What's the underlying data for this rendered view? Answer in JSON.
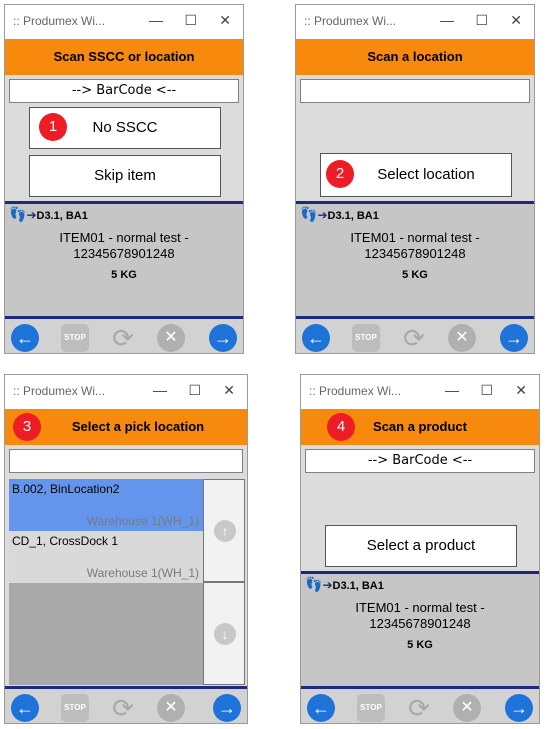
{
  "window_title": ":: Produmex Wi...",
  "controls": {
    "minimize": "—",
    "maximize": "☐",
    "close": "✕"
  },
  "item": {
    "location": "D3.1, BA1",
    "name": "ITEM01 - normal test -",
    "code": "12345678901248",
    "qty": "5 KG"
  },
  "panel1": {
    "badge": "1",
    "header": "Scan SSCC or location",
    "barcode": "--> BarCode <--",
    "no_sscc": "No SSCC",
    "skip": "Skip item"
  },
  "panel2": {
    "badge": "2",
    "header": "Scan a location",
    "barcode": "",
    "select_location": "Select location"
  },
  "panel3": {
    "badge": "3",
    "header": "Select a pick location",
    "search": "",
    "rows": [
      {
        "name": "B.002, BinLocation2",
        "warehouse": "Warehouse 1(WH_1)"
      },
      {
        "name": "CD_1, CrossDock 1",
        "warehouse": "Warehouse 1(WH_1)"
      }
    ]
  },
  "panel4": {
    "badge": "4",
    "header": "Scan a product",
    "barcode": "--> BarCode <--",
    "select_product": "Select a product"
  },
  "toolbar": {
    "back": "←",
    "stop": "STOP",
    "refresh": "⟳",
    "cancel": "✕",
    "next": "→"
  },
  "colors": {
    "header": "#f7890c",
    "selected_row": "#6495ed",
    "accent_blue": "#1e73d8",
    "badge_red": "#ee1c24"
  }
}
